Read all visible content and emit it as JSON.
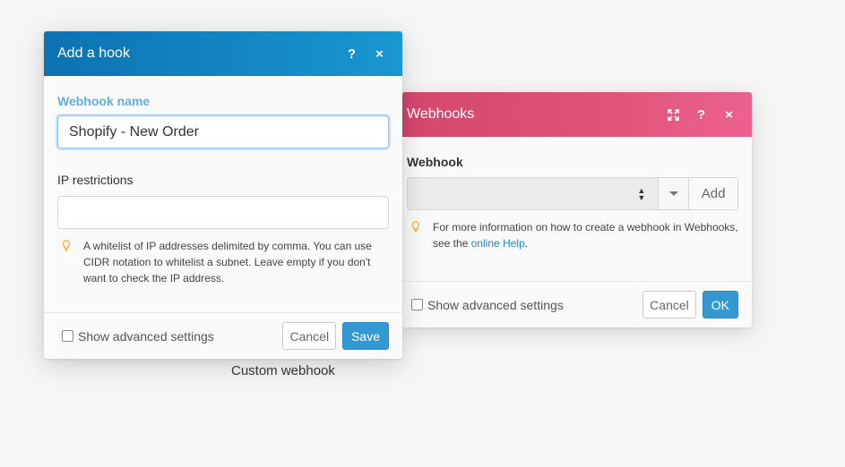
{
  "webhooks_dialog": {
    "title": "Webhooks",
    "field_label": "Webhook",
    "select_value": "",
    "add_label": "Add",
    "hint_text": "For more information on how to create a webhook in Webhooks, see the ",
    "hint_link": "online Help",
    "hint_end": ".",
    "advanced_label": "Show advanced settings",
    "cancel_label": "Cancel",
    "ok_label": "OK",
    "accent": "#e05479"
  },
  "hook_dialog": {
    "title": "Add a hook",
    "name_label": "Webhook name",
    "name_value": "Shopify - New Order",
    "ip_label": "IP restrictions",
    "ip_value": "",
    "hint_text": "A whitelist of IP addresses delimited by comma. You can use CIDR notation to whitelist a subnet. Leave empty if you don't want to check the IP address.",
    "advanced_label": "Show advanced settings",
    "cancel_label": "Cancel",
    "save_label": "Save",
    "accent": "#1488c4"
  },
  "icons": {
    "help": "?",
    "close": "×",
    "expand": "expand-icon"
  },
  "caption": "Custom webhook"
}
